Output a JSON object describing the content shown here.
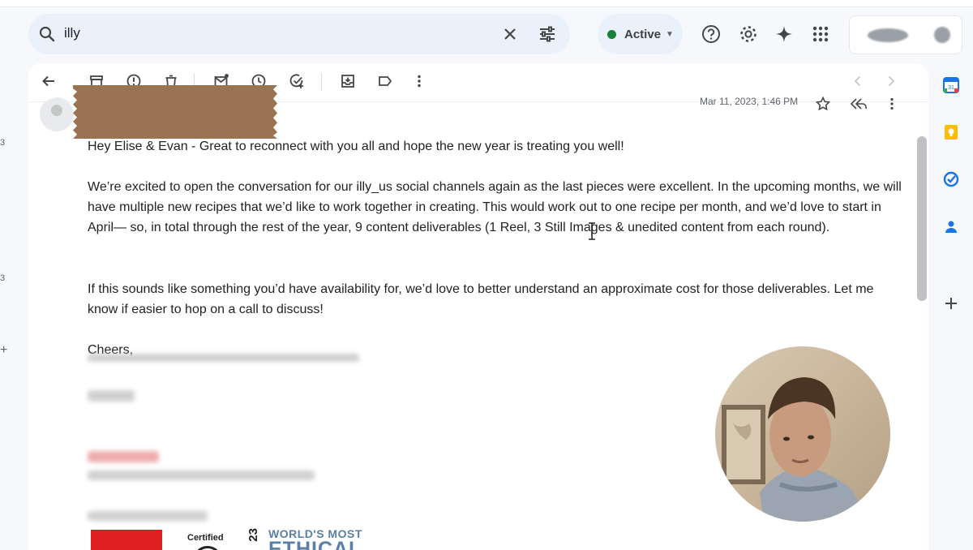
{
  "search": {
    "query": "illy"
  },
  "status": {
    "label": "Active"
  },
  "rail": {
    "counts": [
      "3",
      "3"
    ],
    "plus": "+"
  },
  "email": {
    "date": "Mar 11, 2023, 1:46 PM",
    "paragraphs": [
      "Hey Elise & Evan - Great to reconnect with you all and hope the new year is treating you well!",
      "We’re excited to open the conversation for our illy_us social channels again as the last pieces were excellent. In the upcoming months, we will have multiple new recipes that we’d like to work together in creating. This would work out to one recipe per month, and we’d love to start in April— so, in total through the rest of the year, 9 content deliverables (1 Reel, 3 Still Images & unedited content from each round).",
      "If this sounds like something you’d have availability for, we’d love to better understand an approximate cost for those deliverables. Let me know if easier to hop on a call to discuss!",
      "Cheers,"
    ],
    "signature_logos": {
      "certified": "Certified",
      "ethical_year": "23",
      "ethical_line1": "WORLD'S MOST",
      "ethical_line2": "ETHICAL"
    }
  },
  "colors": {
    "accent": "#0b57d0",
    "status_green": "#188038",
    "redaction": "#9a7352"
  }
}
